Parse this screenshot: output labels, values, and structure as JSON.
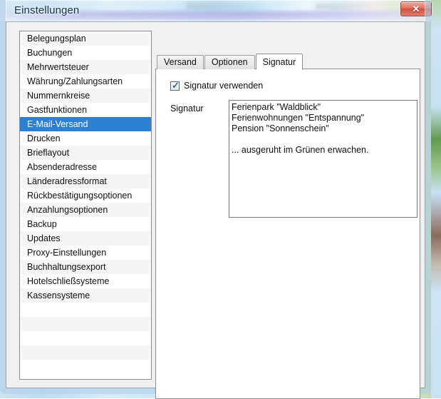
{
  "window": {
    "title": "Einstellungen",
    "close_label": "✕",
    "close_icon": "close-icon"
  },
  "categories": [
    {
      "label": "Belegungsplan",
      "selected": false
    },
    {
      "label": "Buchungen",
      "selected": false
    },
    {
      "label": "Mehrwertsteuer",
      "selected": false
    },
    {
      "label": "Währung/Zahlungsarten",
      "selected": false
    },
    {
      "label": "Nummernkreise",
      "selected": false
    },
    {
      "label": "Gastfunktionen",
      "selected": false
    },
    {
      "label": "E-Mail-Versand",
      "selected": true
    },
    {
      "label": "Drucken",
      "selected": false
    },
    {
      "label": "Brieflayout",
      "selected": false
    },
    {
      "label": "Absenderadresse",
      "selected": false
    },
    {
      "label": "Länderadressformat",
      "selected": false
    },
    {
      "label": "Rückbestätigungsoptionen",
      "selected": false
    },
    {
      "label": "Anzahlungsoptionen",
      "selected": false
    },
    {
      "label": "Backup",
      "selected": false
    },
    {
      "label": "Updates",
      "selected": false
    },
    {
      "label": "Proxy-Einstellungen",
      "selected": false
    },
    {
      "label": "Buchhaltungsexport",
      "selected": false
    },
    {
      "label": "Hotelschließsysteme",
      "selected": false
    },
    {
      "label": "Kassensysteme",
      "selected": false
    },
    {
      "label": "",
      "selected": false
    },
    {
      "label": "",
      "selected": false
    },
    {
      "label": "",
      "selected": false
    },
    {
      "label": "",
      "selected": false
    },
    {
      "label": "",
      "selected": false
    }
  ],
  "tabs": [
    {
      "label": "Versand",
      "active": false
    },
    {
      "label": "Optionen",
      "active": false
    },
    {
      "label": "Signatur",
      "active": true
    }
  ],
  "panel": {
    "use_signature_label": "Signatur verwenden",
    "use_signature_checked": true,
    "signature_label": "Signatur",
    "signature_value": "Ferienpark \"Waldblick\"\nFerienwohnungen \"Entspannung\"\nPension \"Sonnenschein\"\n\n... ausgeruht im Grünen erwachen.",
    "signature_placeholder": ""
  },
  "colors": {
    "selection_blue": "#2f80d2",
    "close_red": "#cf4f3c",
    "panel_bg": "#f0f0f0",
    "field_bg": "#ffffff"
  }
}
